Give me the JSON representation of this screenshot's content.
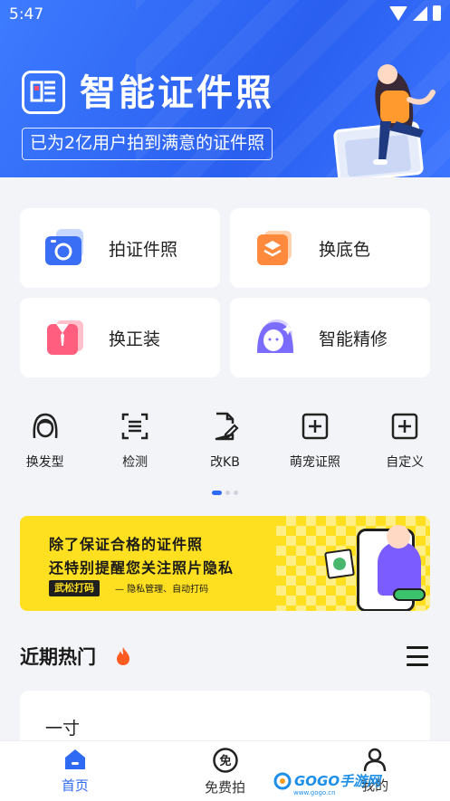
{
  "status_bar": {
    "time": "5:47"
  },
  "hero": {
    "title": "智能证件照",
    "subtitle": "已为2亿用户拍到满意的证件照"
  },
  "feature_cards": [
    {
      "label": "拍证件照",
      "icon": "camera-icon",
      "color": "#3a6ff5"
    },
    {
      "label": "换底色",
      "icon": "layers-icon",
      "color": "#ff8a3d"
    },
    {
      "label": "换正装",
      "icon": "suit-icon",
      "color": "#ff5e7e"
    },
    {
      "label": "智能精修",
      "icon": "face-retouch-icon",
      "color": "#7b6cff"
    }
  ],
  "tools": [
    {
      "label": "换发型",
      "icon": "hairstyle-icon"
    },
    {
      "label": "检测",
      "icon": "scan-icon"
    },
    {
      "label": "改KB",
      "icon": "edit-file-icon"
    },
    {
      "label": "萌宠证照",
      "icon": "add-box-icon"
    },
    {
      "label": "自定义",
      "icon": "add-box-icon"
    }
  ],
  "pager": {
    "pages": 3,
    "active_index": 0
  },
  "banner": {
    "line1": "除了保证合格的证件照",
    "line2": "还特别提醒您关注照片隐私",
    "tag": "武松打码",
    "tag_desc": "— 隐私管理、自动打码",
    "color": "#ffe021"
  },
  "section": {
    "title": "近期热门"
  },
  "recent_items": [
    {
      "title": "一寸"
    }
  ],
  "bottom_nav": [
    {
      "label": "首页",
      "icon": "home-icon",
      "active": true
    },
    {
      "label": "免费拍",
      "icon": "free-shoot-icon",
      "active": false
    },
    {
      "label": "我的",
      "icon": "person-icon",
      "active": false
    }
  ],
  "watermark": {
    "brand": "GOGO手游网",
    "url": "www.gogo.cn"
  },
  "colors": {
    "primary": "#2f6af5",
    "hero_bg": "#3d7bff"
  }
}
